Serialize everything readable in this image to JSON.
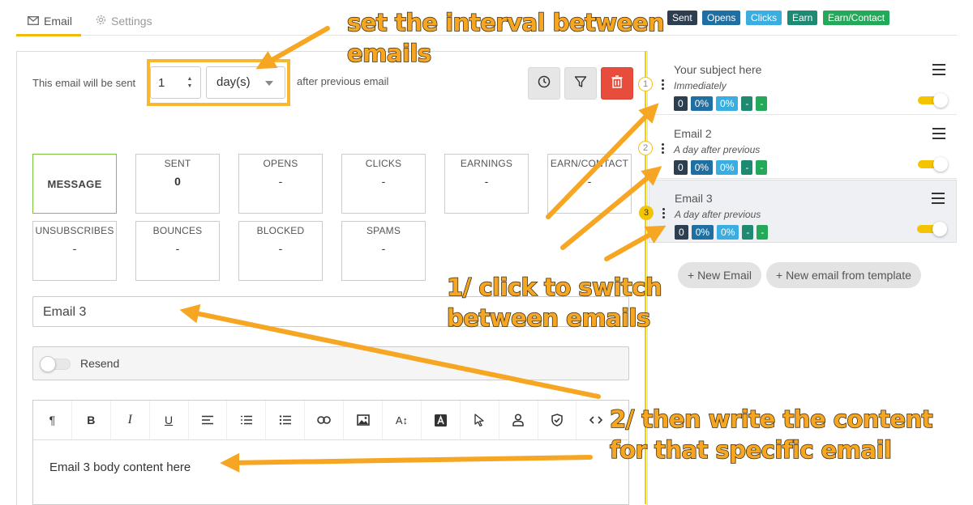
{
  "tabs": [
    {
      "label": "Email",
      "icon": "envelope-icon",
      "active": true
    },
    {
      "label": "Settings",
      "icon": "gear-icon",
      "active": false
    }
  ],
  "legend": [
    {
      "label": "Sent",
      "color": "#2c3e50"
    },
    {
      "label": "Opens",
      "color": "#1f6fa3"
    },
    {
      "label": "Clicks",
      "color": "#3aaee0"
    },
    {
      "label": "Earn",
      "color": "#1e8a72"
    },
    {
      "label": "Earn/Contact",
      "color": "#24a95a"
    }
  ],
  "interval": {
    "prefix": "This email will be sent",
    "value": "1",
    "unit": "day(s)",
    "suffix": "after previous email"
  },
  "toolbar_icons": [
    "clock-icon",
    "filter-icon",
    "trash-icon"
  ],
  "stats": {
    "message_label": "MESSAGE",
    "cards": [
      {
        "label": "SENT",
        "value": "0"
      },
      {
        "label": "OPENS",
        "value": "-"
      },
      {
        "label": "CLICKS",
        "value": "-"
      },
      {
        "label": "EARNINGS",
        "value": "-"
      },
      {
        "label": "EARN/CONTACT",
        "value": "-"
      },
      {
        "label": "UNSUBSCRIBES",
        "value": "-"
      },
      {
        "label": "BOUNCES",
        "value": "-"
      },
      {
        "label": "BLOCKED",
        "value": "-"
      },
      {
        "label": "SPAMS",
        "value": "-"
      }
    ]
  },
  "subject": {
    "value": "Email 3"
  },
  "resend": {
    "label": "Resend"
  },
  "editor": {
    "buttons": [
      "¶",
      "B",
      "I",
      "U"
    ],
    "body": "Email 3 body content here"
  },
  "emails": [
    {
      "step": "1",
      "title": "Your subject here",
      "timing": "Immediately",
      "badges": [
        "0",
        "0%",
        "0%",
        "-",
        "-"
      ],
      "active": false
    },
    {
      "step": "2",
      "title": "Email 2",
      "timing": "A day after previous",
      "badges": [
        "0",
        "0%",
        "0%",
        "-",
        "-"
      ],
      "active": false
    },
    {
      "step": "3",
      "title": "Email 3",
      "timing": "A day after previous",
      "badges": [
        "0",
        "0%",
        "0%",
        "-",
        "-"
      ],
      "active": true
    }
  ],
  "actions": {
    "new_email": "+ New Email",
    "new_from_template": "+ New email from template"
  },
  "annotations": {
    "interval": "set the interval between\nemails",
    "switch": "1/ click to switch\nbetween emails",
    "content": "2/ then write the content\nfor that specific email",
    "color": "#f6a623"
  }
}
